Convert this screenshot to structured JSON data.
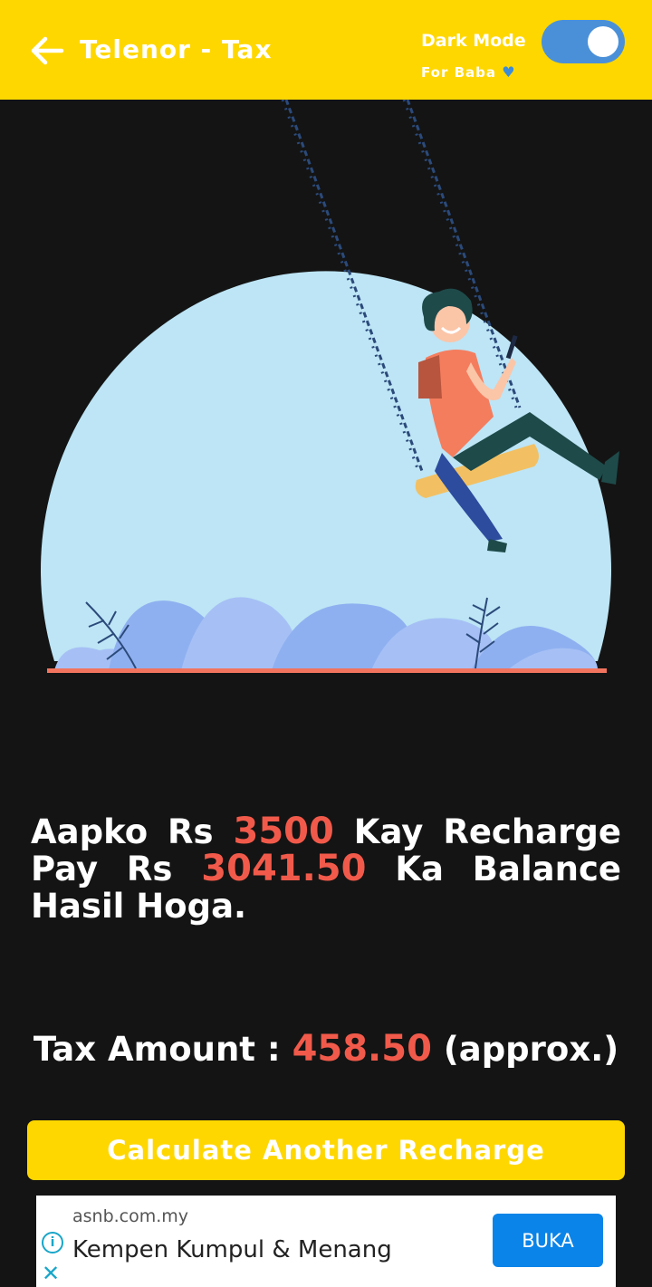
{
  "app_bar": {
    "title": "Telenor - Tax",
    "dark_mode_label": "Dark Mode",
    "dark_mode_sub": "For Baba",
    "dark_mode_on": true,
    "back_icon": "arrow-left-icon",
    "heart_icon": "blue-heart-icon"
  },
  "result": {
    "line_prefix": "Aapko Rs",
    "recharge_amount": "3500",
    "line_mid": "Kay Recharge Pay Rs",
    "balance_amount": "3041.50",
    "line_suffix": "Ka Balance Hasil Hoga."
  },
  "tax": {
    "label": "Tax Amount :",
    "amount": "458.50",
    "note": "(approx.)"
  },
  "calculate_button": "Calculate Another Recharge",
  "ad": {
    "domain": "asnb.com.my",
    "title": "Kempen Kumpul & Menang",
    "cta": "BUKA"
  },
  "colors": {
    "accent_yellow": "#FFD700",
    "highlight_red": "#F15A4A",
    "background": "#141414",
    "toggle_blue": "#4A90D9"
  }
}
